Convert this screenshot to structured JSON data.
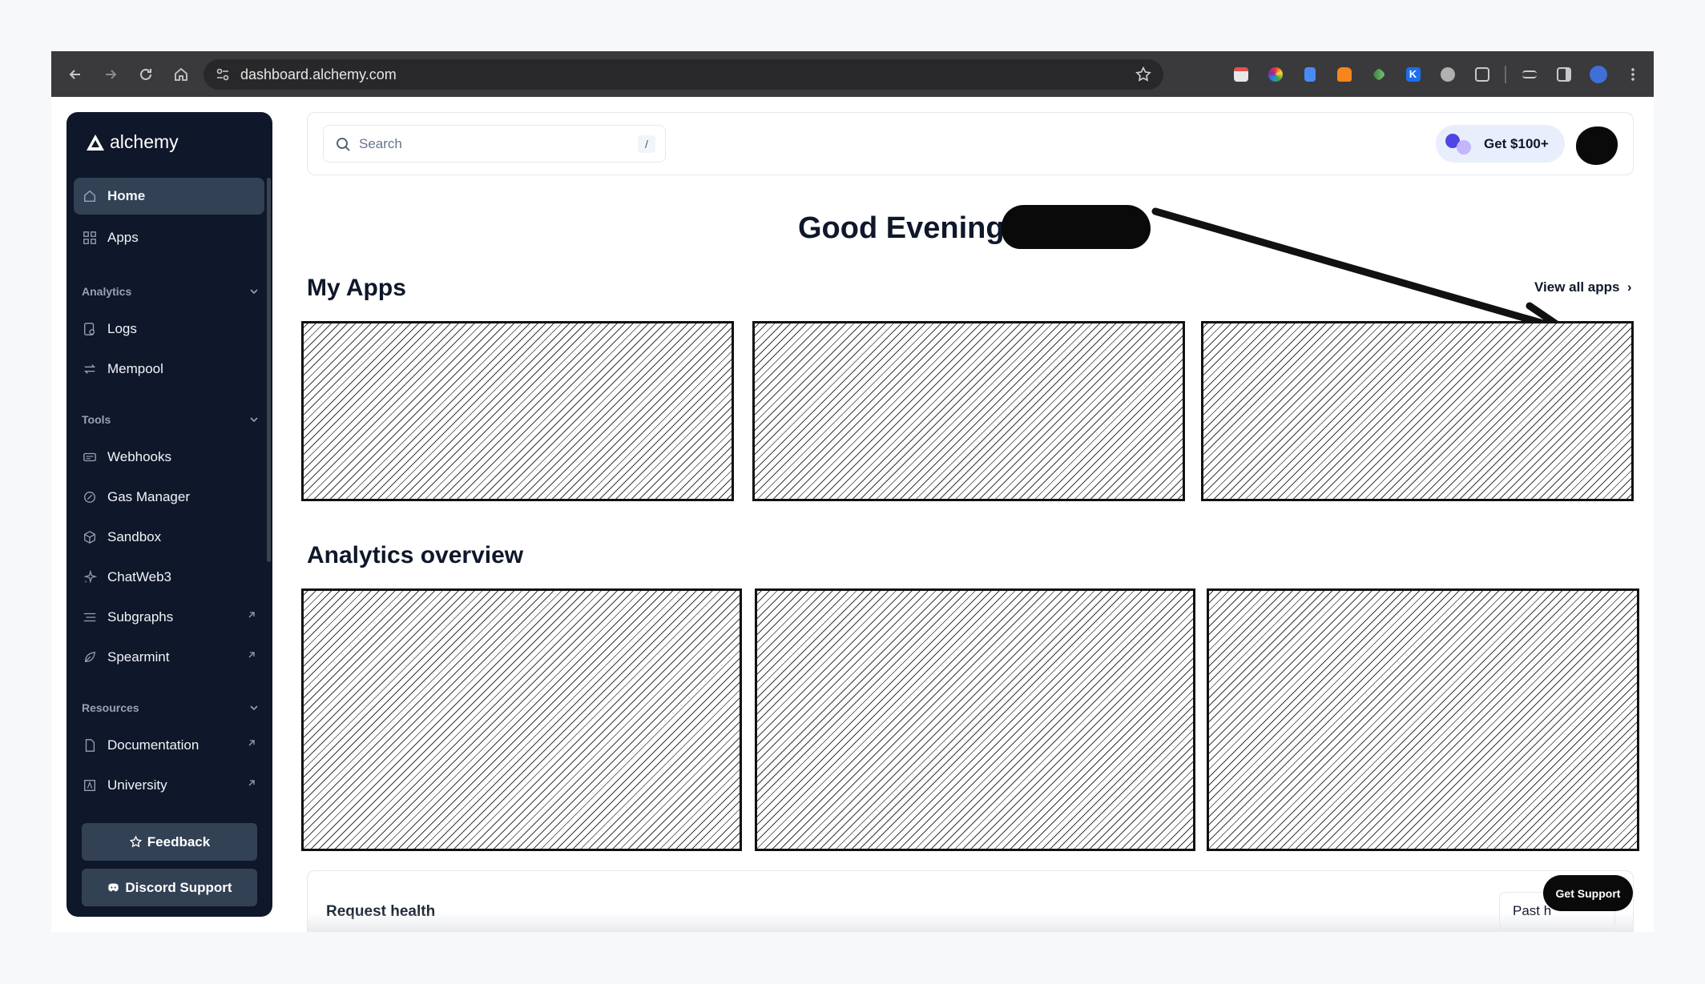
{
  "browser": {
    "url": "dashboard.alchemy.com"
  },
  "sidebar": {
    "brand": "alchemy",
    "items": [
      {
        "label": "Home"
      },
      {
        "label": "Apps"
      }
    ],
    "sections": [
      {
        "title": "Analytics",
        "items": [
          {
            "label": "Logs"
          },
          {
            "label": "Mempool"
          }
        ]
      },
      {
        "title": "Tools",
        "items": [
          {
            "label": "Webhooks"
          },
          {
            "label": "Gas Manager"
          },
          {
            "label": "Sandbox"
          },
          {
            "label": "ChatWeb3"
          },
          {
            "label": "Subgraphs"
          },
          {
            "label": "Spearmint"
          }
        ]
      },
      {
        "title": "Resources",
        "items": [
          {
            "label": "Documentation"
          },
          {
            "label": "University"
          }
        ]
      }
    ],
    "feedback_label": "Feedback",
    "discord_label": "Discord Support"
  },
  "header": {
    "search_placeholder": "Search",
    "search_shortcut": "/",
    "promo_label": "Get $100+"
  },
  "main": {
    "greeting": "Good Evening,",
    "my_apps_title": "My Apps",
    "view_all_label": "View all apps",
    "analytics_title": "Analytics overview",
    "request_health_title": "Request health",
    "past_label": "Past h",
    "get_support_label": "Get Support"
  }
}
